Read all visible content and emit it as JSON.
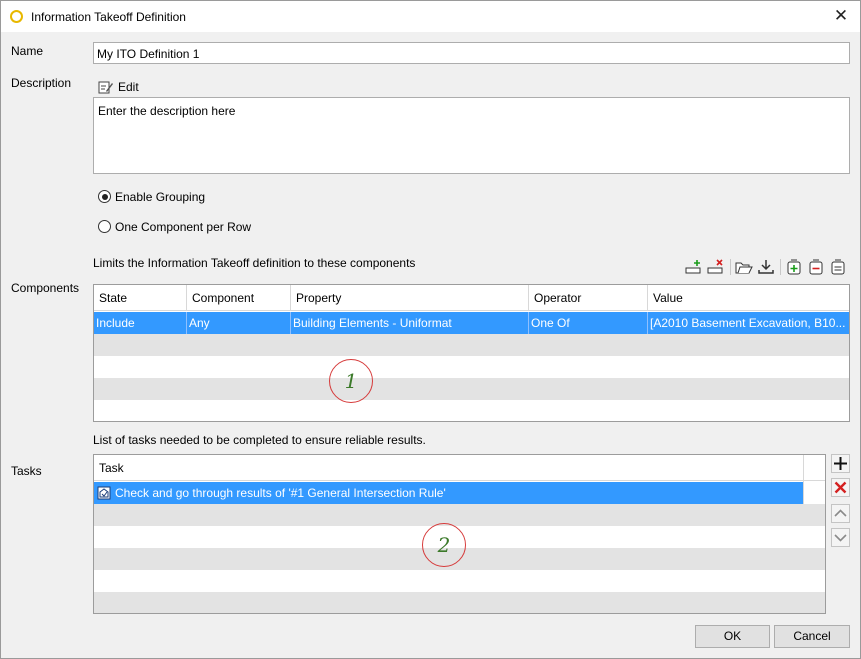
{
  "window": {
    "title": "Information Takeoff Definition",
    "close_glyph": "✕"
  },
  "form": {
    "name_label": "Name",
    "name_value": "My ITO Definition 1",
    "description_label": "Description",
    "edit_label": "Edit",
    "description_value": "Enter the description here",
    "grouping_options": [
      {
        "label": "Enable Grouping",
        "selected": true
      },
      {
        "label": "One Component per Row",
        "selected": false
      }
    ]
  },
  "components": {
    "label": "Components",
    "hint": "Limits the Information Takeoff definition to these components",
    "columns": [
      "State",
      "Component",
      "Property",
      "Operator",
      "Value"
    ],
    "rows": [
      {
        "state": "Include",
        "component": "Any",
        "property": "Building Elements - Uniformat",
        "operator": "One Of",
        "value": "[A2010 Basement Excavation, B10..."
      }
    ],
    "toolbar_icons": [
      "add-row-icon",
      "remove-row-icon",
      "open-folder-icon",
      "download-icon",
      "add-group-icon",
      "group-icon",
      "group-alt-icon"
    ],
    "marker": "1"
  },
  "tasks": {
    "label": "Tasks",
    "hint": "List of tasks needed to be completed to ensure reliable results.",
    "columns": [
      "Task"
    ],
    "rows": [
      {
        "text": "Check and go through results of '#1 General Intersection Rule'"
      }
    ],
    "marker": "2"
  },
  "footer": {
    "ok_label": "OK",
    "cancel_label": "Cancel"
  },
  "colors": {
    "selection": "#3399ff",
    "marker_circle": "#d63a3a",
    "marker_text": "#3c7a2a"
  }
}
